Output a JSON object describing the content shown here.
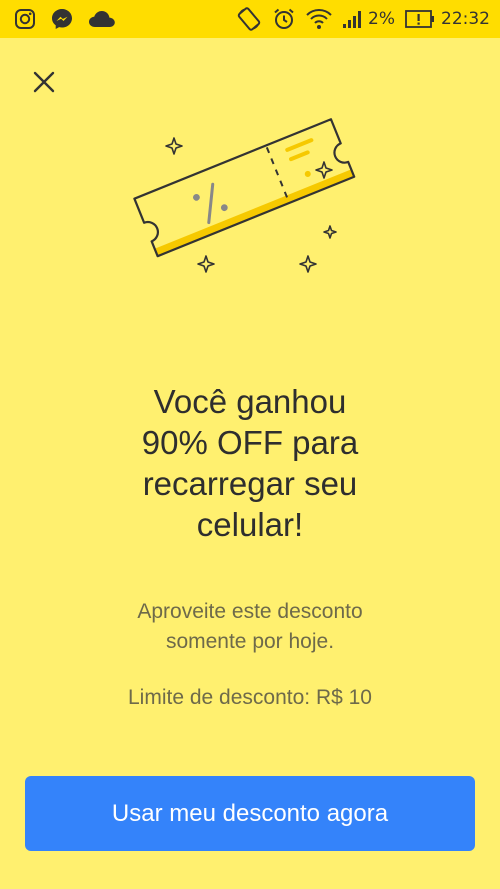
{
  "status_bar": {
    "battery_percent": "2%",
    "time": "22:32",
    "notification_icons": [
      "instagram-icon",
      "messenger-icon",
      "cloud-icon"
    ],
    "system_icons": [
      "rotate-icon",
      "alarm-icon",
      "wifi-icon",
      "signal-icon",
      "battery-alert-icon"
    ],
    "background_color": "#ffdd00"
  },
  "close": {
    "icon": "close-icon"
  },
  "illustration": {
    "icon": "discount-coupon-icon",
    "symbol": "%"
  },
  "headline": "Você ganhou\n90% OFF para\nrecarregar seu\ncelular!",
  "subtext": "Aproveite este desconto\nsomente por hoje.",
  "limit_text": "Limite de desconto: R$ 10",
  "cta": {
    "label": "Usar meu desconto agora",
    "color": "#3483fa"
  },
  "colors": {
    "background": "#fff06f",
    "accent": "#ffdd00"
  }
}
